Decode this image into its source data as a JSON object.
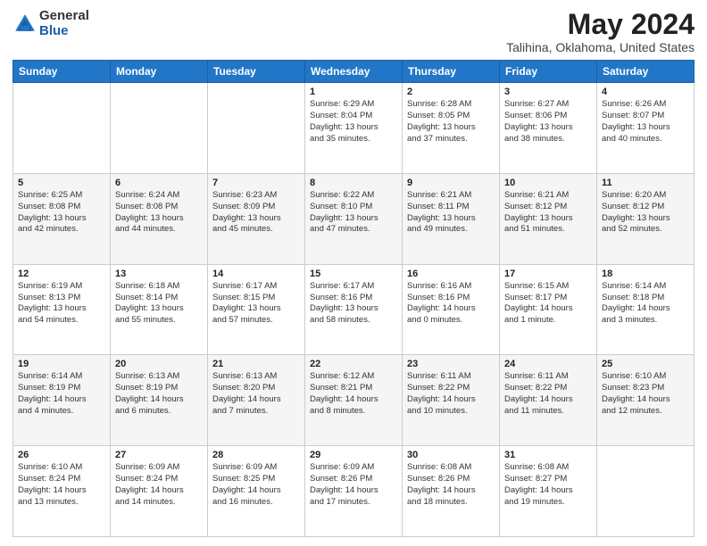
{
  "header": {
    "logo_general": "General",
    "logo_blue": "Blue",
    "month_year": "May 2024",
    "location": "Talihina, Oklahoma, United States"
  },
  "weekdays": [
    "Sunday",
    "Monday",
    "Tuesday",
    "Wednesday",
    "Thursday",
    "Friday",
    "Saturday"
  ],
  "weeks": [
    [
      {
        "day": "",
        "info": ""
      },
      {
        "day": "",
        "info": ""
      },
      {
        "day": "",
        "info": ""
      },
      {
        "day": "1",
        "info": "Sunrise: 6:29 AM\nSunset: 8:04 PM\nDaylight: 13 hours\nand 35 minutes."
      },
      {
        "day": "2",
        "info": "Sunrise: 6:28 AM\nSunset: 8:05 PM\nDaylight: 13 hours\nand 37 minutes."
      },
      {
        "day": "3",
        "info": "Sunrise: 6:27 AM\nSunset: 8:06 PM\nDaylight: 13 hours\nand 38 minutes."
      },
      {
        "day": "4",
        "info": "Sunrise: 6:26 AM\nSunset: 8:07 PM\nDaylight: 13 hours\nand 40 minutes."
      }
    ],
    [
      {
        "day": "5",
        "info": "Sunrise: 6:25 AM\nSunset: 8:08 PM\nDaylight: 13 hours\nand 42 minutes."
      },
      {
        "day": "6",
        "info": "Sunrise: 6:24 AM\nSunset: 8:08 PM\nDaylight: 13 hours\nand 44 minutes."
      },
      {
        "day": "7",
        "info": "Sunrise: 6:23 AM\nSunset: 8:09 PM\nDaylight: 13 hours\nand 45 minutes."
      },
      {
        "day": "8",
        "info": "Sunrise: 6:22 AM\nSunset: 8:10 PM\nDaylight: 13 hours\nand 47 minutes."
      },
      {
        "day": "9",
        "info": "Sunrise: 6:21 AM\nSunset: 8:11 PM\nDaylight: 13 hours\nand 49 minutes."
      },
      {
        "day": "10",
        "info": "Sunrise: 6:21 AM\nSunset: 8:12 PM\nDaylight: 13 hours\nand 51 minutes."
      },
      {
        "day": "11",
        "info": "Sunrise: 6:20 AM\nSunset: 8:12 PM\nDaylight: 13 hours\nand 52 minutes."
      }
    ],
    [
      {
        "day": "12",
        "info": "Sunrise: 6:19 AM\nSunset: 8:13 PM\nDaylight: 13 hours\nand 54 minutes."
      },
      {
        "day": "13",
        "info": "Sunrise: 6:18 AM\nSunset: 8:14 PM\nDaylight: 13 hours\nand 55 minutes."
      },
      {
        "day": "14",
        "info": "Sunrise: 6:17 AM\nSunset: 8:15 PM\nDaylight: 13 hours\nand 57 minutes."
      },
      {
        "day": "15",
        "info": "Sunrise: 6:17 AM\nSunset: 8:16 PM\nDaylight: 13 hours\nand 58 minutes."
      },
      {
        "day": "16",
        "info": "Sunrise: 6:16 AM\nSunset: 8:16 PM\nDaylight: 14 hours\nand 0 minutes."
      },
      {
        "day": "17",
        "info": "Sunrise: 6:15 AM\nSunset: 8:17 PM\nDaylight: 14 hours\nand 1 minute."
      },
      {
        "day": "18",
        "info": "Sunrise: 6:14 AM\nSunset: 8:18 PM\nDaylight: 14 hours\nand 3 minutes."
      }
    ],
    [
      {
        "day": "19",
        "info": "Sunrise: 6:14 AM\nSunset: 8:19 PM\nDaylight: 14 hours\nand 4 minutes."
      },
      {
        "day": "20",
        "info": "Sunrise: 6:13 AM\nSunset: 8:19 PM\nDaylight: 14 hours\nand 6 minutes."
      },
      {
        "day": "21",
        "info": "Sunrise: 6:13 AM\nSunset: 8:20 PM\nDaylight: 14 hours\nand 7 minutes."
      },
      {
        "day": "22",
        "info": "Sunrise: 6:12 AM\nSunset: 8:21 PM\nDaylight: 14 hours\nand 8 minutes."
      },
      {
        "day": "23",
        "info": "Sunrise: 6:11 AM\nSunset: 8:22 PM\nDaylight: 14 hours\nand 10 minutes."
      },
      {
        "day": "24",
        "info": "Sunrise: 6:11 AM\nSunset: 8:22 PM\nDaylight: 14 hours\nand 11 minutes."
      },
      {
        "day": "25",
        "info": "Sunrise: 6:10 AM\nSunset: 8:23 PM\nDaylight: 14 hours\nand 12 minutes."
      }
    ],
    [
      {
        "day": "26",
        "info": "Sunrise: 6:10 AM\nSunset: 8:24 PM\nDaylight: 14 hours\nand 13 minutes."
      },
      {
        "day": "27",
        "info": "Sunrise: 6:09 AM\nSunset: 8:24 PM\nDaylight: 14 hours\nand 14 minutes."
      },
      {
        "day": "28",
        "info": "Sunrise: 6:09 AM\nSunset: 8:25 PM\nDaylight: 14 hours\nand 16 minutes."
      },
      {
        "day": "29",
        "info": "Sunrise: 6:09 AM\nSunset: 8:26 PM\nDaylight: 14 hours\nand 17 minutes."
      },
      {
        "day": "30",
        "info": "Sunrise: 6:08 AM\nSunset: 8:26 PM\nDaylight: 14 hours\nand 18 minutes."
      },
      {
        "day": "31",
        "info": "Sunrise: 6:08 AM\nSunset: 8:27 PM\nDaylight: 14 hours\nand 19 minutes."
      },
      {
        "day": "",
        "info": ""
      }
    ]
  ]
}
